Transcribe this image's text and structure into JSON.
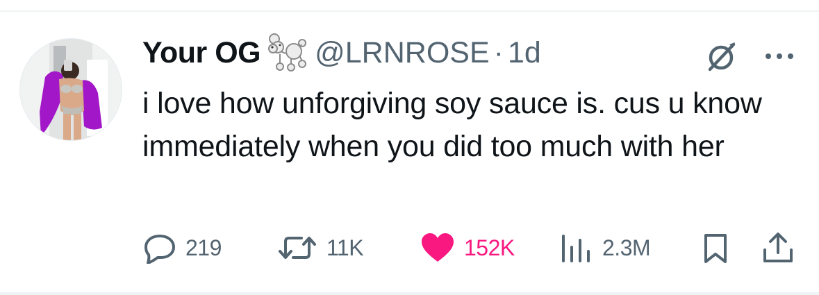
{
  "tweet": {
    "display_name": "Your OG",
    "handle": "@LRNROSE",
    "separator": "·",
    "time": "1d",
    "text": "i love how unforgiving soy sauce is. cus u know immediately when you did too much with her"
  },
  "icons": {
    "name_badge": "poodle-emoji",
    "grok": "grok-icon",
    "more": "more-icon"
  },
  "actions": {
    "replies": "219",
    "reposts": "11K",
    "likes": "152K",
    "views": "2.3M"
  },
  "colors": {
    "text": "#0f1419",
    "secondary": "#536471",
    "like": "#f91880",
    "divider": "#eff3f4"
  }
}
